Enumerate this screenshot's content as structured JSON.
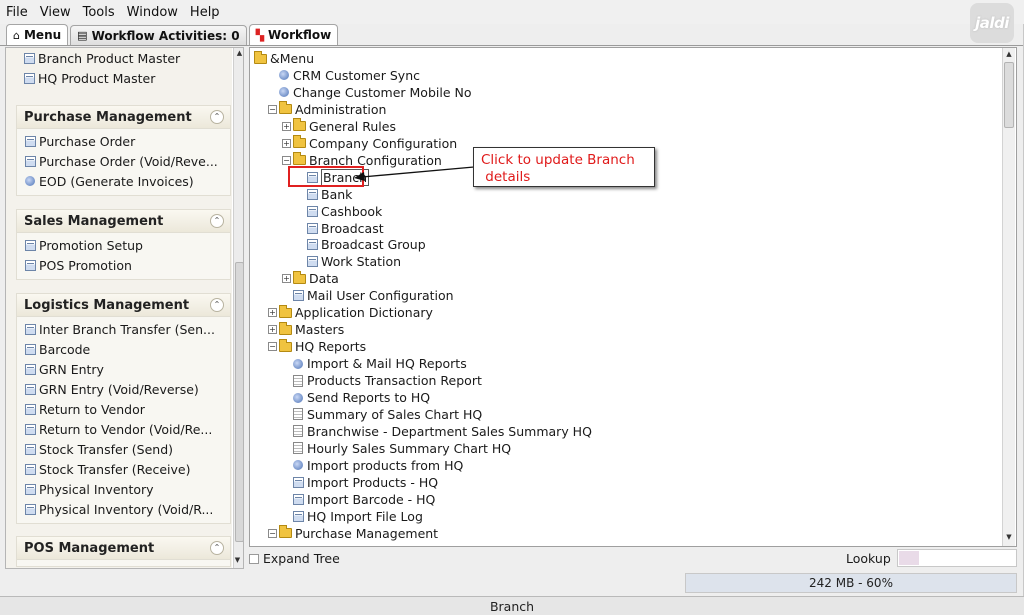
{
  "menubar": [
    {
      "label": "File",
      "name": "menu-file"
    },
    {
      "label": "View",
      "name": "menu-view"
    },
    {
      "label": "Tools",
      "name": "menu-tools"
    },
    {
      "label": "Window",
      "name": "menu-window"
    },
    {
      "label": "Help",
      "name": "menu-help"
    }
  ],
  "logo_text": "jaldi",
  "tabs": [
    {
      "label": "Menu",
      "name": "tab-menu",
      "active": true
    },
    {
      "label": "Workflow Activities: 0",
      "name": "tab-workflow-activities",
      "active": false
    },
    {
      "label": "Workflow",
      "name": "tab-workflow",
      "active": false
    }
  ],
  "left_top_items": [
    "Branch Product Master",
    "HQ Product Master"
  ],
  "left_sections": [
    {
      "title": "Purchase Management",
      "items": [
        {
          "label": "Purchase Order",
          "icon": "page-icon"
        },
        {
          "label": "Purchase Order (Void/Reve...",
          "icon": "page-icon"
        },
        {
          "label": "EOD (Generate Invoices)",
          "icon": "gear-icon"
        }
      ]
    },
    {
      "title": "Sales Management",
      "items": [
        {
          "label": "Promotion Setup",
          "icon": "page-icon"
        },
        {
          "label": "POS Promotion",
          "icon": "page-icon"
        }
      ]
    },
    {
      "title": "Logistics Management",
      "items": [
        {
          "label": "Inter Branch Transfer (Sen...",
          "icon": "page-icon"
        },
        {
          "label": "Barcode",
          "icon": "page-icon"
        },
        {
          "label": "GRN Entry",
          "icon": "page-icon"
        },
        {
          "label": "GRN Entry (Void/Reverse)",
          "icon": "page-icon"
        },
        {
          "label": "Return to Vendor",
          "icon": "page-icon"
        },
        {
          "label": "Return to Vendor (Void/Re...",
          "icon": "page-icon"
        },
        {
          "label": "Stock Transfer (Send)",
          "icon": "page-icon"
        },
        {
          "label": "Stock Transfer (Receive)",
          "icon": "page-icon"
        },
        {
          "label": "Physical Inventory",
          "icon": "page-icon"
        },
        {
          "label": "Physical Inventory (Void/R...",
          "icon": "page-icon"
        }
      ]
    },
    {
      "title": "POS Management",
      "items": []
    }
  ],
  "tree": [
    {
      "label": "&Menu",
      "level": 0,
      "kind": "folder-open",
      "toggle": null
    },
    {
      "label": "CRM Customer Sync",
      "level": 1,
      "kind": "gear",
      "toggle": null
    },
    {
      "label": "Change Customer Mobile No",
      "level": 1,
      "kind": "gear",
      "toggle": null
    },
    {
      "label": "Administration",
      "level": 1,
      "kind": "folder-open",
      "toggle": "-"
    },
    {
      "label": "General Rules",
      "level": 2,
      "kind": "folder",
      "toggle": "+"
    },
    {
      "label": "Company Configuration",
      "level": 2,
      "kind": "folder",
      "toggle": "+"
    },
    {
      "label": "Branch Configuration",
      "level": 2,
      "kind": "folder-open",
      "toggle": "-"
    },
    {
      "label": "Branch",
      "level": 3,
      "kind": "page",
      "toggle": null,
      "selected": true
    },
    {
      "label": "Bank",
      "level": 3,
      "kind": "page",
      "toggle": null
    },
    {
      "label": "Cashbook",
      "level": 3,
      "kind": "page",
      "toggle": null
    },
    {
      "label": "Broadcast",
      "level": 3,
      "kind": "page",
      "toggle": null
    },
    {
      "label": "Broadcast Group",
      "level": 3,
      "kind": "page",
      "toggle": null
    },
    {
      "label": "Work Station",
      "level": 3,
      "kind": "page",
      "toggle": null
    },
    {
      "label": "Data",
      "level": 2,
      "kind": "folder",
      "toggle": "+"
    },
    {
      "label": "Mail User Configuration",
      "level": 2,
      "kind": "page",
      "toggle": null
    },
    {
      "label": "Application Dictionary",
      "level": 1,
      "kind": "folder",
      "toggle": "+"
    },
    {
      "label": "Masters",
      "level": 1,
      "kind": "folder",
      "toggle": "+"
    },
    {
      "label": "HQ Reports",
      "level": 1,
      "kind": "folder-open",
      "toggle": "-"
    },
    {
      "label": "Import & Mail HQ Reports",
      "level": 2,
      "kind": "gear",
      "toggle": null
    },
    {
      "label": "Products Transaction Report",
      "level": 2,
      "kind": "doc",
      "toggle": null
    },
    {
      "label": "Send Reports to HQ",
      "level": 2,
      "kind": "gear",
      "toggle": null
    },
    {
      "label": "Summary of Sales Chart HQ",
      "level": 2,
      "kind": "doc",
      "toggle": null
    },
    {
      "label": "Branchwise - Department Sales Summary HQ",
      "level": 2,
      "kind": "doc",
      "toggle": null
    },
    {
      "label": "Hourly Sales Summary Chart HQ",
      "level": 2,
      "kind": "doc",
      "toggle": null
    },
    {
      "label": "Import products from HQ",
      "level": 2,
      "kind": "gear",
      "toggle": null
    },
    {
      "label": "Import Products - HQ",
      "level": 2,
      "kind": "page",
      "toggle": null
    },
    {
      "label": "Import Barcode - HQ",
      "level": 2,
      "kind": "page",
      "toggle": null
    },
    {
      "label": "HQ Import File Log",
      "level": 2,
      "kind": "page",
      "toggle": null
    },
    {
      "label": "Purchase Management",
      "level": 1,
      "kind": "folder-open",
      "toggle": "-"
    }
  ],
  "callout_text": "Click to update Branch\n details",
  "expand_tree_label": "Expand Tree",
  "lookup_label": "Lookup",
  "memory_text": "242 MB - 60%",
  "status_text": "Branch"
}
